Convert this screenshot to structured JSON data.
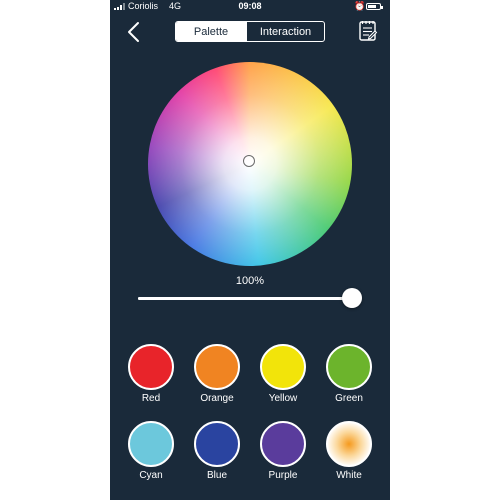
{
  "status_bar": {
    "carrier": "Coriolis",
    "network": "4G",
    "time": "09:08"
  },
  "nav": {
    "tabs": [
      {
        "label": "Palette",
        "selected": true
      },
      {
        "label": "Interaction",
        "selected": false
      }
    ]
  },
  "brightness": {
    "label": "100%",
    "value": 1.0
  },
  "colors": {
    "background": "#1a2a3a",
    "accent": "#ffffff"
  },
  "presets": [
    {
      "label": "Red",
      "color": "#e8242a"
    },
    {
      "label": "Orange",
      "color": "#f08422"
    },
    {
      "label": "Yellow",
      "color": "#f2e40a"
    },
    {
      "label": "Green",
      "color": "#6cb42c"
    },
    {
      "label": "Cyan",
      "color": "#6cc8dc"
    },
    {
      "label": "Blue",
      "color": "#2a44a0"
    },
    {
      "label": "Purple",
      "color": "#5a3c9c"
    },
    {
      "label": "White",
      "color": "radial-gradient(circle, #f59a1e 0%, #fbd79a 40%, #ffffff 75%)"
    }
  ]
}
